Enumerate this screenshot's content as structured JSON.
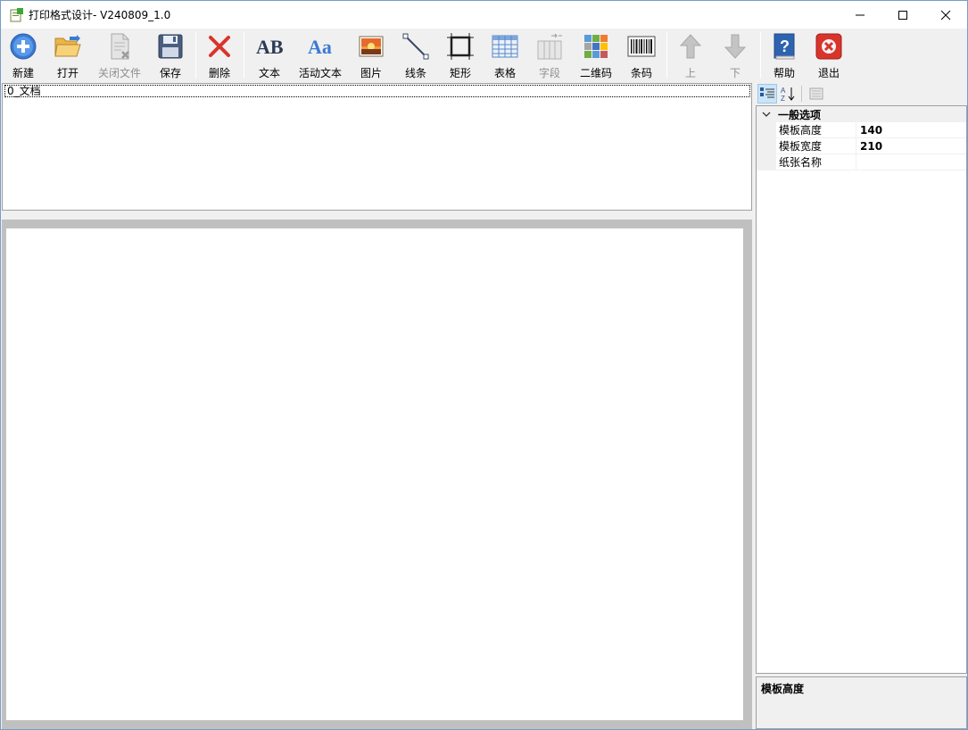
{
  "window": {
    "title": "打印格式设计- V240809_1.0"
  },
  "toolbar": {
    "new": "新建",
    "open": "打开",
    "close_file": "关闭文件",
    "save": "保存",
    "delete": "删除",
    "text": "文本",
    "active_text": "活动文本",
    "image": "图片",
    "line": "线条",
    "rect": "矩形",
    "table": "表格",
    "field": "字段",
    "qrcode": "二维码",
    "barcode": "条码",
    "up": "上",
    "down": "下",
    "help": "帮助",
    "exit": "退出"
  },
  "tree": {
    "items": [
      "0_文档"
    ]
  },
  "properties": {
    "category": "一般选项",
    "rows": [
      {
        "name": "模板高度",
        "value": "140"
      },
      {
        "name": "模板宽度",
        "value": "210"
      },
      {
        "name": "纸张名称",
        "value": ""
      }
    ],
    "description_title": "模板高度"
  },
  "colors": {
    "accent_blue": "#3a7ad4",
    "danger_red": "#d9342b",
    "border_gray": "#a0a0a0"
  }
}
